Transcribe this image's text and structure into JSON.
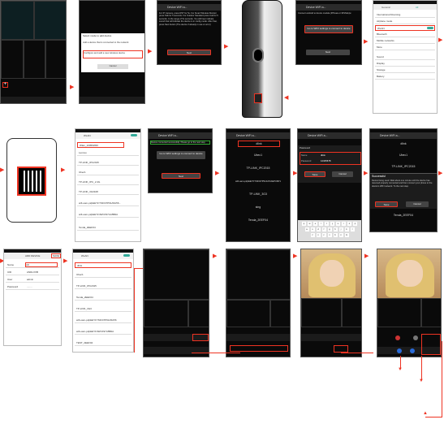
{
  "step1": {
    "plus_icon": "plus-icon"
  },
  "step2": {
    "dialog_title": "Select mode to add device",
    "option_1": "Add a device that is connected to the network",
    "option_2": "Configure and add a new wireless device",
    "cancel": "Cancel"
  },
  "step3": {
    "header": "Device WiFi a...",
    "body": "For IP Camera, press RST for 5s. For Smart Wireless Monitor press Talk for 5 seconds. For Outdoor Standard press Call for 5 seconds. In the range of 5s seconds. You will hear indicate sound that will indicate the device is in config mode. After that, press Next button (The device if already in use or error)",
    "next": "Next"
  },
  "step4": {
    "header": "Device WiFi a...",
    "body": "Connect android to device module (IPSnaw or IRSNdo)w",
    "go_wifi": "Go to WIFI settings to connect to device",
    "next": "Next"
  },
  "step5": {
    "tabs": [
      "General",
      "All"
    ],
    "items": [
      "International Roaming",
      "Airplane mode",
      "WLAN",
      "Bluetooth",
      "Mobile networks",
      "More",
      "Sound",
      "Display",
      "Storage",
      "Battery"
    ]
  },
  "step6": {
    "qr_label": "qr-code"
  },
  "step7": {
    "title": "WLAN",
    "networks": [
      "Wlan_10059WIFI",
      "Lenovo",
      "TP-LINK_IPC2015",
      "Ubec1",
      "TP-LINK_IPC_2.4G",
      "TP-LINK_3G3108",
      "wifi-oam-p2pEEYFYMO47P91A5A56...",
      "wifi-oam-p2pEEYF4WCF97AA5B0A",
      "Tenda_2EEF04"
    ]
  },
  "step8": {
    "header": "Device WiFi a...",
    "body": "Device connected successfully. Please go to the next step.",
    "go_wifi": "Go to WIFI settings to connect to device",
    "next": "Next"
  },
  "step9": {
    "header": "Device WiFi a...",
    "list": [
      "dlink",
      "Ubec1",
      "TP-LINK_IPC2015",
      "wifi-oam-p2pEEYFYMO47P91AXXAEPU6P1",
      "TP-LINK_3G3",
      "sing",
      "Tenda_2EEF04"
    ]
  },
  "step10": {
    "header": "Device WiFi a...",
    "password_title": "Password",
    "name_label": "Name",
    "name_value": "dlink",
    "password_label": "Password",
    "password_value": "12345678",
    "save": "Save",
    "cancel": "Cancel",
    "keys": [
      "q",
      "w",
      "e",
      "r",
      "t",
      "y",
      "u",
      "i",
      "o",
      "p",
      "a",
      "s",
      "d",
      "f",
      "g",
      "h",
      "j",
      "k",
      "l",
      "z",
      "x",
      "c",
      "v",
      "b",
      "n",
      "m"
    ]
  },
  "step11": {
    "header": "Device WiFi a...",
    "dialog_title": "Successful",
    "dialog_body": "Device being used. Wait about one minute until the device has resumed properly connected and then connect your phone to the device's WIFI network. To the next step.",
    "save": "Save",
    "cancel": "Cancel",
    "list": [
      "dlink",
      "Ubec1",
      "TP-LINK_IPC2015",
      "TP-LINK_3G3",
      "Tenda_2EEF04"
    ]
  },
  "step12": {
    "title": "ADD DEVICE",
    "save": "SAVE",
    "name_label": "Name",
    "name_value": "cdt",
    "uid_label": "UID",
    "uid_value": "ANDLXXB",
    "user_label": "User",
    "user_value": "admin",
    "password_label": "Password",
    "password_value": "........"
  },
  "step13": {
    "title": "WLAN",
    "networks": [
      "dlink",
      "Ubec1",
      "TP-LINK_IPC2015",
      "Tenda_2EEF04",
      "TP-LINK_3G3",
      "wifi-oam-p2pEEYFYMO47P91A5A56",
      "wifi-oam-p2pEEYF4WCF97A5B0A",
      "TEST_2EEF04"
    ]
  },
  "colors": {
    "accent": "#e32222",
    "wlan_accent": "#33aa99"
  }
}
